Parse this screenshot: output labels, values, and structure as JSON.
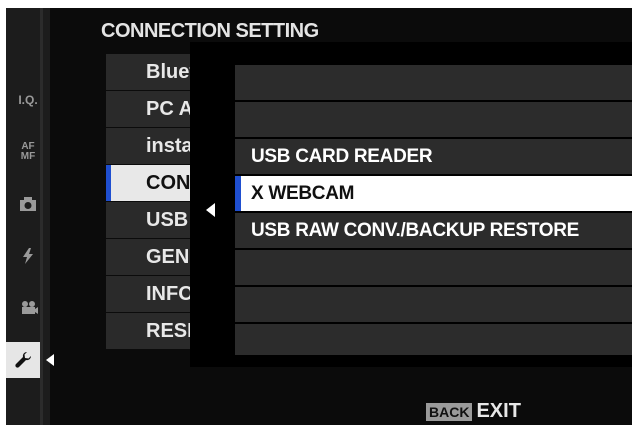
{
  "menu": {
    "title": "CONNECTION SETTING",
    "items": [
      {
        "label": "Bluetooth SETTINGS"
      },
      {
        "label": "PC AUTO SAVE"
      },
      {
        "label": "instax PRINTER CONNECTION SETTING"
      },
      {
        "label": "CONNECTION MODE",
        "selected": true
      },
      {
        "label": "USB POWER SUPPLY/COMM SETTING"
      },
      {
        "label": "GENERAL SETTINGS"
      },
      {
        "label": "INFORMATION"
      },
      {
        "label": "RESET WIRELESS SETTING"
      }
    ]
  },
  "sidebar": {
    "tabs": [
      {
        "label": "I.Q.",
        "icon": "image-quality-icon"
      },
      {
        "label": "AF MF",
        "icon": "af-mf-icon"
      },
      {
        "label": "",
        "icon": "camera-icon"
      },
      {
        "label": "",
        "icon": "flash-icon"
      },
      {
        "label": "",
        "icon": "movie-icon"
      },
      {
        "label": "",
        "icon": "wrench-icon",
        "active": true
      }
    ]
  },
  "popup": {
    "options": [
      {
        "label": ""
      },
      {
        "label": ""
      },
      {
        "label": "USB CARD READER"
      },
      {
        "label": "X WEBCAM",
        "selected": true
      },
      {
        "label": "USB RAW CONV./BACKUP RESTORE"
      },
      {
        "label": ""
      },
      {
        "label": ""
      },
      {
        "label": ""
      }
    ]
  },
  "footer": {
    "back_badge": "BACK",
    "exit_label": "EXIT"
  },
  "colors": {
    "accent": "#1f4fd0",
    "selected_bg": "#ffffff",
    "row_bg": "#2c2c2c"
  }
}
